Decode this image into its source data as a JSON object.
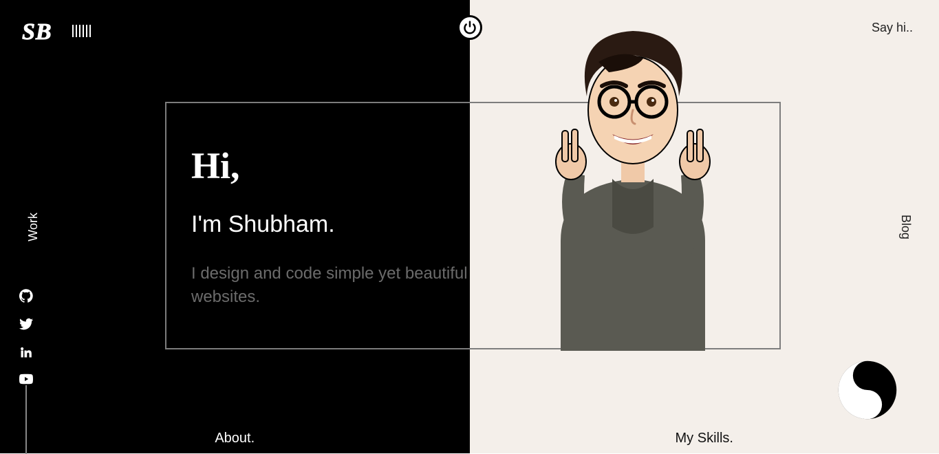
{
  "brand": {
    "logo_text": "SB"
  },
  "nav": {
    "say_hi": "Say hi..",
    "side_left": "Work",
    "side_right": "Blog"
  },
  "hero": {
    "greeting": "Hi,",
    "intro": "I'm Shubham.",
    "tagline": "I design and code simple yet beautiful websites."
  },
  "bottom": {
    "left": "About.",
    "right": "My Skills."
  },
  "social": {
    "github": "github-icon",
    "twitter": "twitter-icon",
    "linkedin": "linkedin-icon",
    "youtube": "youtube-icon"
  }
}
